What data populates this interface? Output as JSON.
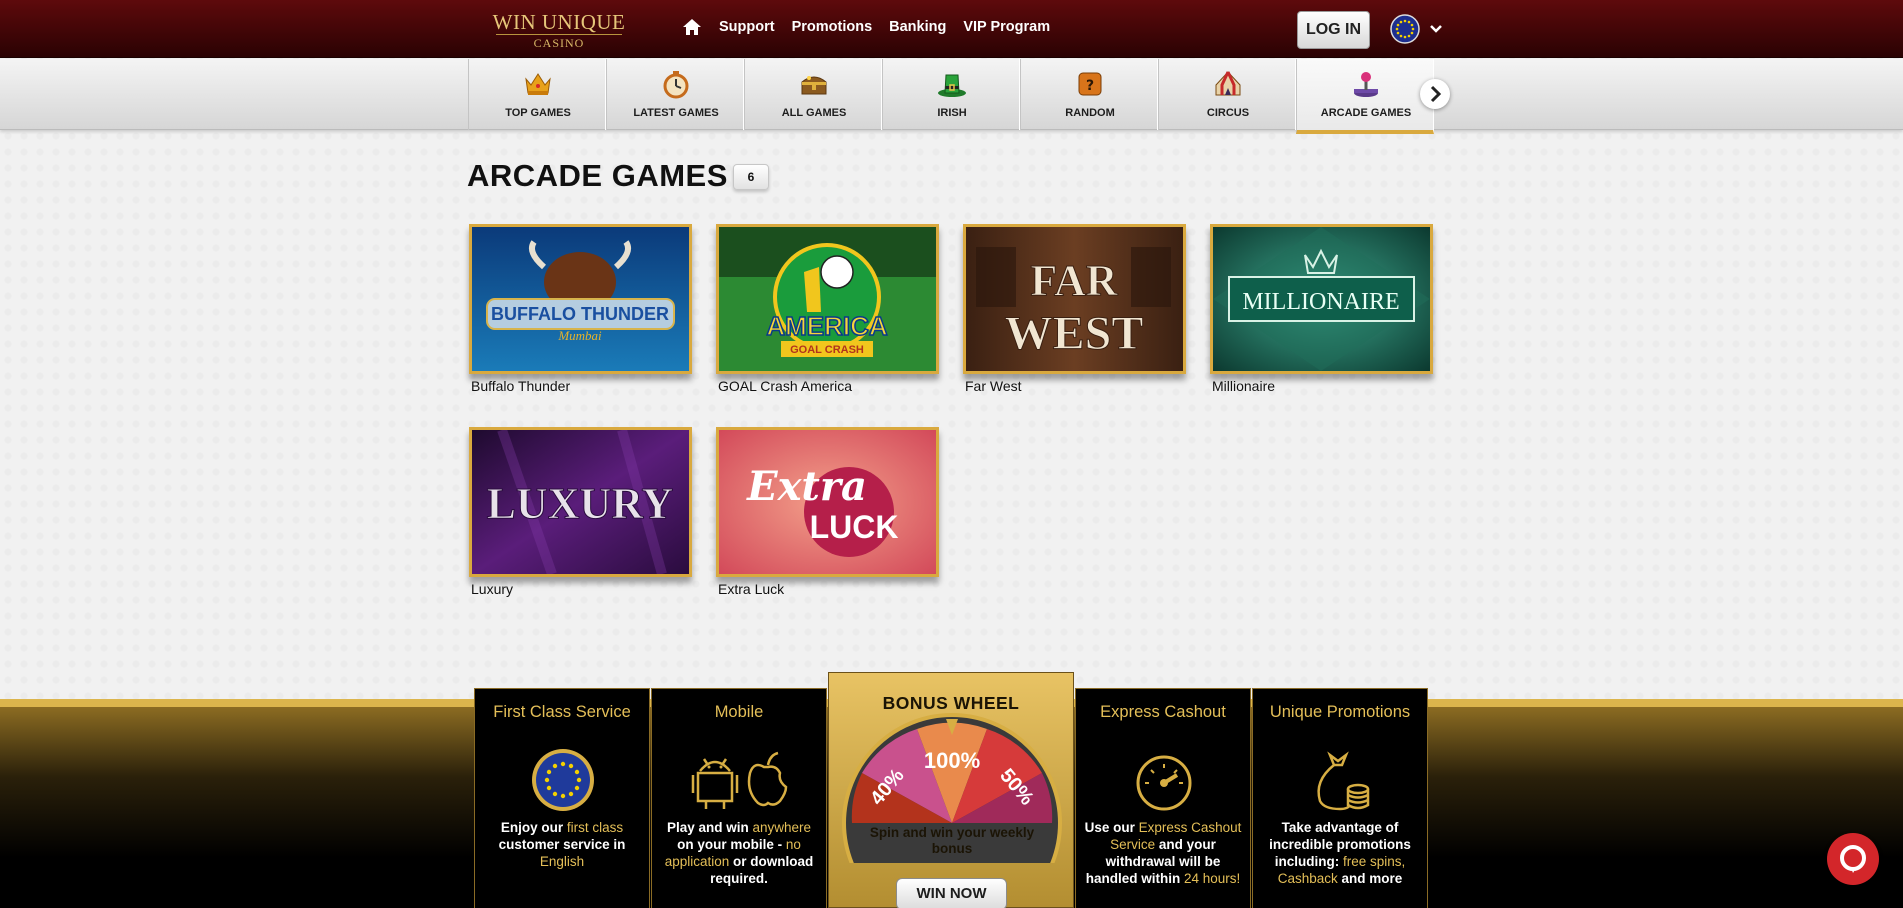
{
  "header": {
    "logo_main": "WIN UNIQUE",
    "logo_sub": "CASINO",
    "nav": [
      "Support",
      "Promotions",
      "Banking",
      "VIP Program"
    ],
    "login_label": "LOG IN"
  },
  "categories": [
    {
      "label": "TOP GAMES",
      "icon": "crown-icon"
    },
    {
      "label": "LATEST GAMES",
      "icon": "stopwatch-icon"
    },
    {
      "label": "ALL GAMES",
      "icon": "treasure-chest-icon"
    },
    {
      "label": "IRISH",
      "icon": "leprechaun-hat-icon"
    },
    {
      "label": "RANDOM",
      "icon": "dice-icon"
    },
    {
      "label": "CIRCUS",
      "icon": "circus-tent-icon"
    },
    {
      "label": "ARCADE GAMES",
      "icon": "joystick-icon",
      "active": true
    }
  ],
  "page": {
    "title": "ARCADE GAMES",
    "count": "6"
  },
  "games": [
    {
      "name": "Buffalo Thunder",
      "art_text": "BUFFALO THUNDER"
    },
    {
      "name": "GOAL Crash America",
      "art_text": "AMERICA",
      "art_sub": "GOAL CRASH"
    },
    {
      "name": "Far West",
      "art_text": "FAR",
      "art_text2": "WEST"
    },
    {
      "name": "Millionaire",
      "art_text": "MILLIONAIRE"
    },
    {
      "name": "Luxury",
      "art_text": "LUXURY"
    },
    {
      "name": "Extra Luck",
      "art_text": "Extra",
      "art_text2": "LUCK"
    }
  ],
  "features": {
    "first_class": {
      "title": "First Class Service",
      "t1": "Enjoy our ",
      "h1": "first class",
      "t2": " customer service in ",
      "h2": "English"
    },
    "mobile": {
      "title": "Mobile",
      "t1": "Play and win ",
      "h1": "anywhere",
      "t2": " on your mobile - ",
      "h2": "no application",
      "t3": " or download required."
    },
    "bonus_wheel": {
      "title": "BONUS WHEEL",
      "segments": [
        "40%",
        "100%",
        "50%"
      ],
      "text": "Spin and win your weekly bonus",
      "button": "WIN NOW"
    },
    "express": {
      "title": "Express Cashout",
      "t1": "Use our ",
      "h1": "Express Cashout Service",
      "t2": " and your withdrawal will be handled within ",
      "h2": "24 hours!"
    },
    "promotions": {
      "title": "Unique Promotions",
      "t1": "Take advantage of incredible promotions including: ",
      "h1": "free spins, Cashback",
      "t2": " and more"
    }
  },
  "colors": {
    "header_bg": "#5e0a0c",
    "gold": "#d9a93e",
    "chat": "#d3262a"
  }
}
